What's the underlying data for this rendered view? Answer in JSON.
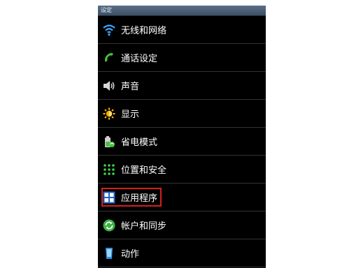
{
  "header": {
    "title": "设定"
  },
  "settings": {
    "items": [
      {
        "label": "无线和网络",
        "icon": "wifi-icon"
      },
      {
        "label": "通话设定",
        "icon": "phone-icon"
      },
      {
        "label": "声音",
        "icon": "speaker-icon"
      },
      {
        "label": "显示",
        "icon": "brightness-icon"
      },
      {
        "label": "省电模式",
        "icon": "battery-recycle-icon"
      },
      {
        "label": "位置和安全",
        "icon": "pattern-lock-icon"
      },
      {
        "label": "应用程序",
        "icon": "apps-grid-icon"
      },
      {
        "label": "帐户和同步",
        "icon": "sync-icon"
      },
      {
        "label": "动作",
        "icon": "phone-tilt-icon"
      }
    ]
  },
  "highlight": {
    "item": "应用程序",
    "color": "#d71d1d"
  }
}
